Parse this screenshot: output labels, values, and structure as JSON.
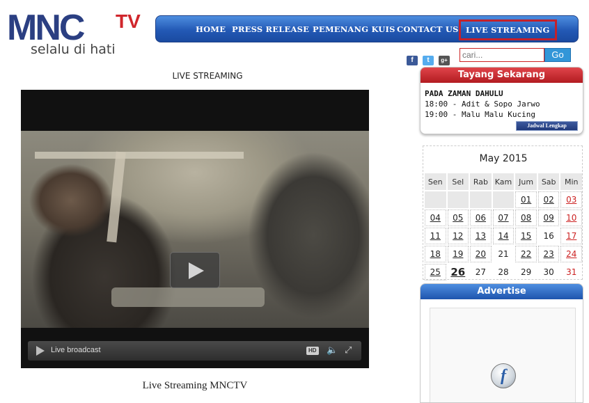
{
  "logo": {
    "brand": "MNC",
    "brand_suffix": "TV",
    "tagline": "selalu di hati"
  },
  "nav": {
    "items": [
      "HOME",
      "PRESS RELEASE",
      "PEMENANG KUIS",
      "CONTACT US",
      "LIVE STREAMING"
    ],
    "active": "LIVE STREAMING"
  },
  "social": {
    "facebook": "f",
    "twitter": "t",
    "googleplus": "g+"
  },
  "search": {
    "placeholder": "cari...",
    "button": "Go"
  },
  "main": {
    "heading": "LIVE STREAMING",
    "player": {
      "label": "Live broadcast",
      "hd": "HD"
    },
    "caption": "Live Streaming MNCTV"
  },
  "now_playing": {
    "title": "Tayang Sekarang",
    "program": "PADA ZAMAN DAHULU",
    "schedule": [
      "18:00 - Adit & Sopo Jarwo",
      "19:00 - Malu Malu Kucing"
    ],
    "button": "Jadwal Lengkap"
  },
  "calendar": {
    "title": "May 2015",
    "days": [
      "Sen",
      "Sel",
      "Rab",
      "Kam",
      "Jum",
      "Sab",
      "Min"
    ],
    "weeks": [
      [
        "",
        "",
        "",
        "",
        "01",
        "02",
        "03"
      ],
      [
        "04",
        "05",
        "06",
        "07",
        "08",
        "09",
        "10"
      ],
      [
        "11",
        "12",
        "13",
        "14",
        "15",
        "16",
        "17"
      ],
      [
        "18",
        "19",
        "20",
        "21",
        "22",
        "23",
        "24"
      ],
      [
        "25",
        "26",
        "27",
        "28",
        "29",
        "30",
        "31"
      ]
    ],
    "today": "26"
  },
  "advertise": {
    "title": "Advertise"
  },
  "colors": {
    "nav_blue": "#2359b5",
    "accent_red": "#c4202a",
    "logo_blue": "#2b3f82"
  }
}
